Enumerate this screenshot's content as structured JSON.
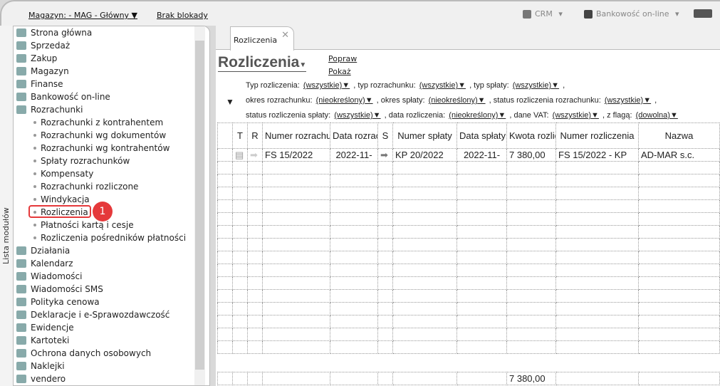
{
  "topbar": {
    "magazyn": "Magazyn: - MAG - Główny",
    "blokada": "Brak blokady",
    "crm": "CRM",
    "bank": "Bankowość on-line"
  },
  "left_strip": {
    "label": "Lista modułów"
  },
  "sidebar": {
    "items": [
      "Strona główna",
      "Sprzedaż",
      "Zakup",
      "Magazyn",
      "Finanse",
      "Bankowość on-line",
      "Rozrachunki"
    ],
    "sub": [
      "Rozrachunki z kontrahentem",
      "Rozrachunki wg dokumentów",
      "Rozrachunki wg kontrahentów",
      "Spłaty rozrachunków",
      "Kompensaty",
      "Rozrachunki rozliczone",
      "Windykacja",
      "Rozliczenia",
      "Płatności kartą i cesje",
      "Rozliczenia pośredników płatności"
    ],
    "items2": [
      "Działania",
      "Kalendarz",
      "Wiadomości",
      "Wiadomości SMS",
      "Polityka cenowa",
      "Deklaracje i e-Sprawozdawczość",
      "Ewidencje",
      "Kartoteki",
      "Ochrona danych osobowych",
      "Naklejki",
      "vendero"
    ]
  },
  "badge": "1",
  "tab": {
    "label": "Rozliczenia",
    "close": "✕"
  },
  "page": {
    "title": "Rozliczenia",
    "popraw": "Popraw",
    "pokaz": "Pokaż"
  },
  "filters": {
    "typ_rozliczenia": "Typ rozliczenia:",
    "v1": "(wszystkie)",
    "typ_rozrachunku": ", typ rozrachunku:",
    "v2": "(wszystkie)",
    "typ_splaty": ", typ spłaty:",
    "v3": "(wszystkie)",
    "okres_rozrachunku": "okres rozrachunku:",
    "v4": "(nieokreślony)",
    "okres_splaty": ", okres spłaty:",
    "v5": "(nieokreślony)",
    "status_rozr": ", status rozliczenia rozrachunku:",
    "v6": "(wszystkie)",
    "status_spl": "status rozliczenia spłaty:",
    "v7": "(wszystkie)",
    "data_rozl": ", data rozliczenia:",
    "v8": "(nieokreślony)",
    "dane_vat": ", dane VAT:",
    "v9": "(wszystkie)",
    "flaga": ", z flagą:",
    "v10": "(dowolna)"
  },
  "table": {
    "headers": [
      "",
      "T",
      "R",
      "Numer rozrachunku",
      "Data rozrachunku",
      "S",
      "Numer spłaty",
      "Data spłaty",
      "Kwota rozliczenia",
      "Numer rozliczenia",
      "Nazwa"
    ],
    "rows": [
      {
        "numer": "FS 15/2022",
        "data": "2022-11-",
        "numer_splaty": "KP 20/2022",
        "data_splaty": "2022-11-",
        "kwota": "7 380,00",
        "numer_rozl": "FS 15/2022 - KP",
        "nazwa": "AD-MAR s.c."
      }
    ],
    "total": "7 380,00"
  }
}
